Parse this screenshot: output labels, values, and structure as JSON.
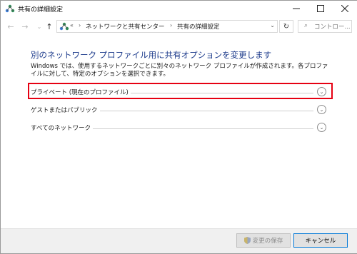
{
  "window": {
    "title": "共有の詳細設定"
  },
  "titlebar": {
    "minimize_icon": "minimize-icon",
    "maximize_icon": "maximize-icon",
    "close_icon": "close-icon"
  },
  "nav": {
    "overflow": "«",
    "breadcrumbs": [
      "ネットワークと共有センター",
      "共有の詳細設定"
    ],
    "search_placeholder": "コントロー..."
  },
  "content": {
    "heading": "別のネットワーク プロファイル用に共有オプションを変更します",
    "description": "Windows では、使用するネットワークごとに別々のネットワーク プロファイルが作成されます。各プロファイルに対して、特定のオプションを選択できます。",
    "sections": [
      {
        "label": "プライベート (現在のプロファイル)",
        "expanded": false,
        "highlighted": true
      },
      {
        "label": "ゲストまたはパブリック",
        "expanded": false,
        "highlighted": false
      },
      {
        "label": "すべてのネットワーク",
        "expanded": false,
        "highlighted": false
      }
    ]
  },
  "footer": {
    "save_label": "変更の保存",
    "cancel_label": "キャンセル"
  },
  "colors": {
    "heading": "#1e3c8c",
    "highlight": "#e60012",
    "cancel_border": "#0078d7"
  }
}
